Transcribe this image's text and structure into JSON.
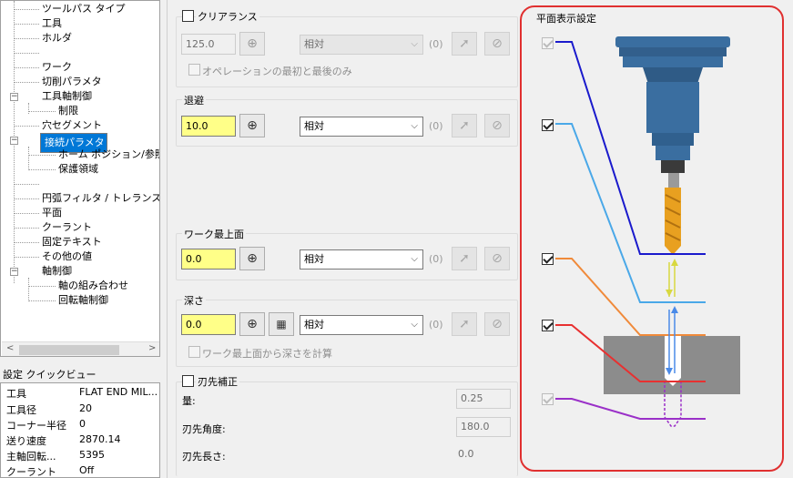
{
  "tree": {
    "items": [
      {
        "label": "ツールパス タイプ"
      },
      {
        "label": "工具"
      },
      {
        "label": "ホルダ"
      },
      {
        "label": ""
      },
      {
        "label": "ワーク"
      },
      {
        "label": "切削パラメタ"
      },
      {
        "label": "工具軸制御"
      },
      {
        "label": "制限"
      },
      {
        "label": "穴セグメント"
      },
      {
        "label": "接続パラメタ"
      },
      {
        "label": "ホーム ポジション/参照点"
      },
      {
        "label": "保護領域"
      },
      {
        "label": ""
      },
      {
        "label": "円弧フィルタ / トレランス"
      },
      {
        "label": "平面"
      },
      {
        "label": "クーラント"
      },
      {
        "label": "固定テキスト"
      },
      {
        "label": "その他の値"
      },
      {
        "label": "軸制御"
      },
      {
        "label": "軸の組み合わせ"
      },
      {
        "label": "回転軸制御"
      }
    ],
    "scroll_left": "<",
    "scroll_right": ">"
  },
  "quickview": {
    "title": "設定 クイックビュー",
    "rows": [
      {
        "key": "工具",
        "value": "FLAT END MIL..."
      },
      {
        "key": "工具径",
        "value": "20"
      },
      {
        "key": "コーナー半径",
        "value": "0"
      },
      {
        "key": "送り速度",
        "value": "2870.14"
      },
      {
        "key": "主軸回転...",
        "value": "5395"
      },
      {
        "key": "クーラント",
        "value": "Off"
      }
    ]
  },
  "clearance": {
    "label": "クリアランス",
    "checked": false,
    "value": "125.0",
    "mode": "相対",
    "count": "(0)",
    "only_first_last": "オペレーションの最初と最後のみ"
  },
  "retract": {
    "label": "退避",
    "value": "10.0",
    "mode": "相対",
    "count": "(0)"
  },
  "top_of_stock": {
    "label": "ワーク最上面",
    "value": "0.0",
    "mode": "相対",
    "count": "(0)"
  },
  "depth": {
    "label": "深さ",
    "value": "0.0",
    "mode": "相対",
    "count": "(0)",
    "calc_from_top": "ワーク最上面から深さを計算"
  },
  "tip_comp": {
    "label": "刃先補正",
    "amount_label": "量:",
    "amount": "0.25",
    "angle_label": "刃先角度:",
    "angle": "180.0",
    "length_label": "刃先長さ:",
    "length": "0.0"
  },
  "plane_display": {
    "title": "平面表示設定"
  },
  "colors": {
    "clearance": "#1a1acc",
    "retract": "#4aa8e8",
    "top_of_stock": "#f08a3a",
    "depth": "#e83030",
    "tip": "#9a30c8",
    "stock": "#8c8c8c",
    "tool_holder": "#3a6ea0",
    "drill": "#e8a020",
    "highlight": "#e03030"
  },
  "icons": {
    "crosshair": "crosshair-icon",
    "pointer": "pointer-icon",
    "no": "prohibit-icon",
    "calculator": "calculator-icon"
  }
}
